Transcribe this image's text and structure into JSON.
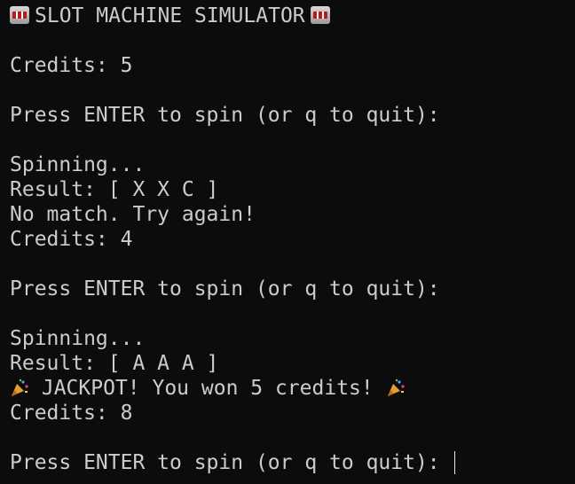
{
  "title": "SLOT MACHINE SIMULATOR",
  "icons": {
    "title_icon": "slot-machine-icon",
    "jackpot_icon": "party-popper-icon"
  },
  "lines": {
    "credits_start": "Credits: 5",
    "prompt": "Press ENTER to spin (or q to quit):",
    "spinning": "Spinning...",
    "result_1": "Result: [ X X C ]",
    "no_match": "No match. Try again!",
    "credits_after_1": "Credits: 4",
    "result_2": "Result: [ A A A ]",
    "jackpot": "JACKPOT! You won 5 credits!",
    "credits_after_2": "Credits: 8"
  }
}
